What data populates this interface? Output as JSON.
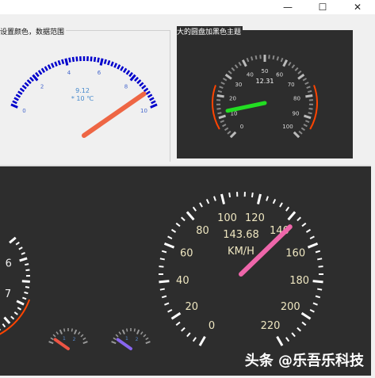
{
  "window": {
    "min_icon": "minimize-icon",
    "max_icon": "maximize-icon",
    "close_icon": "close-icon",
    "min_glyph": "—",
    "max_glyph": "☐",
    "close_glyph": "✕"
  },
  "groups": {
    "left_title": "设置颜色，数据范围",
    "right_title": "大的圆盘加黑色主题"
  },
  "gauge_blue": {
    "ticks": [
      "0",
      "2",
      "4",
      "6",
      "8",
      "10"
    ],
    "value_text": "9.12",
    "temp_text": "* 10 ℃",
    "value": 9.12,
    "min": 0,
    "max": 10,
    "color": "#0000cc",
    "needle_color": "#ee6644"
  },
  "gauge_dark_small": {
    "ticks": [
      "0",
      "10",
      "20",
      "30",
      "40",
      "50",
      "60",
      "70",
      "80",
      "90",
      "100"
    ],
    "value_text": "12.31",
    "value": 12.31,
    "min": 0,
    "max": 100,
    "needle_color": "#22dd22",
    "warn_color": "#ff4400"
  },
  "gauge_left_partial": {
    "ticks": [
      "6",
      "7"
    ]
  },
  "gauge_mini_1": {
    "ticks": [
      "1",
      "2"
    ],
    "needle_color": "#ee5544"
  },
  "gauge_mini_2": {
    "ticks": [
      "1",
      "2"
    ],
    "needle_color": "#8866ee"
  },
  "gauge_speed": {
    "ticks": [
      "0",
      "20",
      "40",
      "60",
      "80",
      "100",
      "120",
      "140",
      "160",
      "180",
      "200",
      "220"
    ],
    "value_text": "143.68",
    "unit_text": "KM/H",
    "value": 143.68,
    "min": 0,
    "max": 220,
    "needle_color": "#ee66aa",
    "label_color": "#eee6c0"
  },
  "watermark": {
    "text": "头条 @乐吾乐科技"
  }
}
